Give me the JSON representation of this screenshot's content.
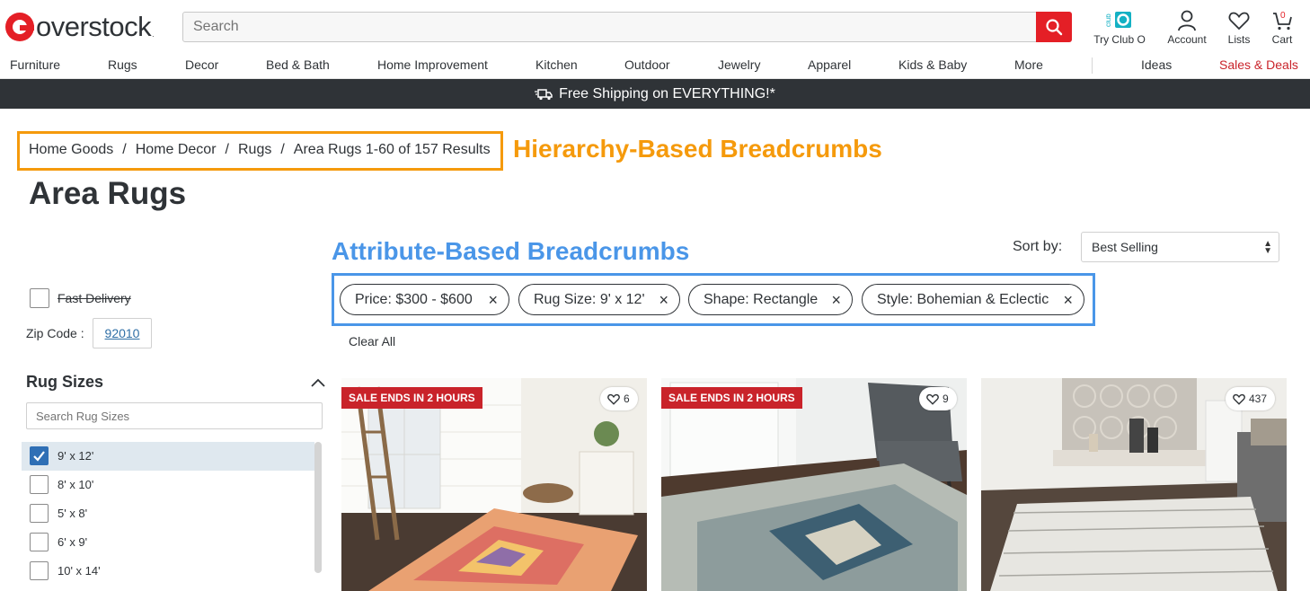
{
  "header": {
    "logo_text": "overstock",
    "logo_tm": ".",
    "search_placeholder": "Search",
    "club_badge": "club",
    "club_label": "Try Club O",
    "account_label": "Account",
    "lists_label": "Lists",
    "cart_label": "Cart",
    "cart_count": "0"
  },
  "nav": {
    "items": [
      "Furniture",
      "Rugs",
      "Decor",
      "Bed & Bath",
      "Home Improvement",
      "Kitchen",
      "Outdoor",
      "Jewelry",
      "Apparel",
      "Kids & Baby",
      "More"
    ],
    "ideas": "Ideas",
    "sales": "Sales & Deals"
  },
  "promo": {
    "text": "Free Shipping on EVERYTHING!*"
  },
  "breadcrumb": {
    "items": [
      "Home Goods",
      "Home Decor",
      "Rugs"
    ],
    "current": "Area Rugs 1-60 of 157 Results",
    "separator": "/"
  },
  "annotations": {
    "hierarchy": "Hierarchy-Based Breadcrumbs",
    "attribute": "Attribute-Based Breadcrumbs"
  },
  "page_title": "Area Rugs",
  "sort": {
    "label": "Sort by:",
    "value": "Best Selling"
  },
  "filters": {
    "chips": [
      "Price: $300 - $600",
      "Rug Size: 9' x 12'",
      "Shape: Rectangle",
      "Style: Bohemian & Eclectic"
    ],
    "clear_all": "Clear All"
  },
  "sidebar": {
    "fast_delivery": "Fast Delivery",
    "zip_label": "Zip Code :",
    "zip_value": "92010",
    "rug_sizes_title": "Rug Sizes",
    "rug_sizes_placeholder": "Search Rug Sizes",
    "rug_sizes": [
      {
        "label": "9' x 12'",
        "checked": true
      },
      {
        "label": "8' x 10'",
        "checked": false
      },
      {
        "label": "5' x 8'",
        "checked": false
      },
      {
        "label": "6' x 9'",
        "checked": false
      },
      {
        "label": "10' x 14'",
        "checked": false
      }
    ]
  },
  "products": [
    {
      "badge": "SALE ENDS IN 2 HOURS",
      "favorites": "6"
    },
    {
      "badge": "SALE ENDS IN 2 HOURS",
      "favorites": "9"
    },
    {
      "badge": "",
      "favorites": "437"
    }
  ],
  "colors": {
    "brand_red": "#e41f26",
    "annotation_orange": "#f59a0c",
    "annotation_blue": "#4a96e8",
    "promo_bar": "#2f3337",
    "sale_badge": "#c9232a",
    "checkbox_blue": "#2f6fb5"
  }
}
